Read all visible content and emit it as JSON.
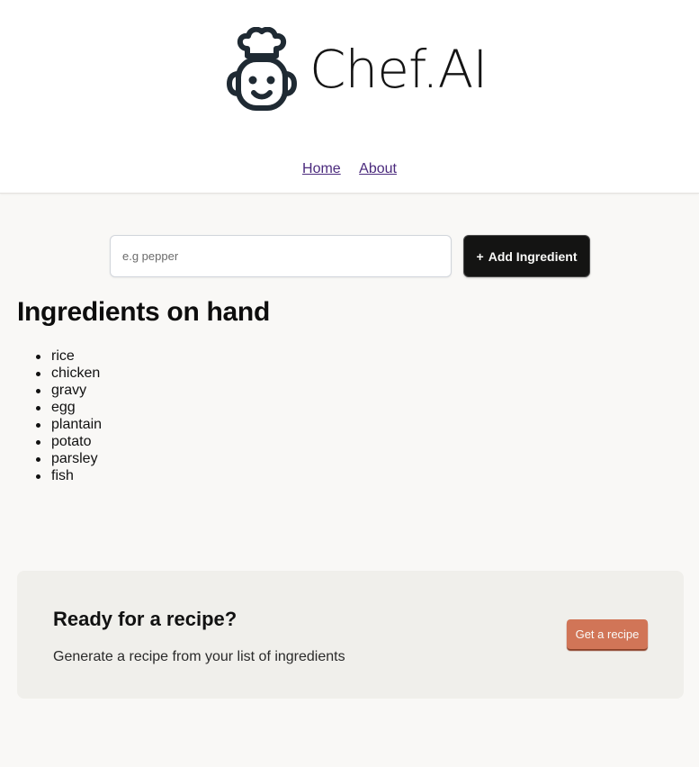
{
  "header": {
    "logo_text": "Chef.AI",
    "logo_icon": "chef-robot-icon"
  },
  "nav": {
    "items": [
      {
        "label": "Home"
      },
      {
        "label": "About"
      }
    ]
  },
  "form": {
    "input_placeholder": "e.g pepper",
    "input_value": "",
    "add_button_icon": "+",
    "add_button_label": "Add Ingredient"
  },
  "ingredients": {
    "heading": "Ingredients on hand",
    "items": [
      "rice",
      "chicken",
      "gravy",
      "egg",
      "plantain",
      "potato",
      "parsley",
      "fish"
    ]
  },
  "recipe_card": {
    "title": "Ready for a recipe?",
    "description": "Generate a recipe from your list of ingredients",
    "button_label": "Get a recipe"
  },
  "colors": {
    "page_background": "#f9f8f6",
    "add_button": "#141413",
    "get_recipe_button": "#d17557",
    "card_background": "#f0efeb",
    "link": "#4b2a7d"
  }
}
